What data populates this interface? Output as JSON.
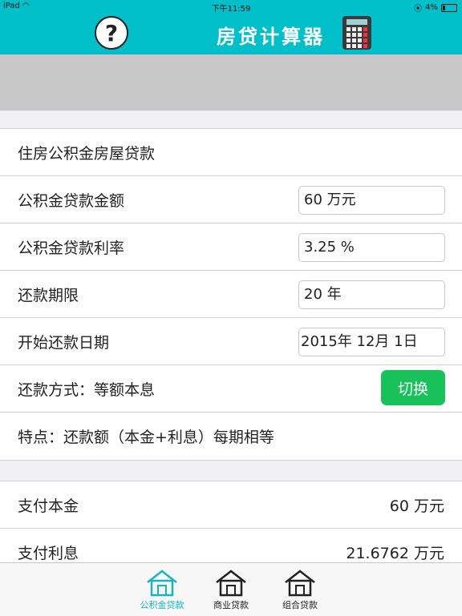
{
  "status_bar": {
    "device": "iPad",
    "time": "下午11:59",
    "battery": "4%"
  },
  "navbar": {
    "help_label": "?",
    "title": "房贷计算器"
  },
  "form": {
    "section_title": "住房公积金房屋贷款",
    "loan_amount_label": "公积金贷款金额",
    "loan_amount_value": "60 万元",
    "rate_label": "公积金贷款利率",
    "rate_value": "3.25 %",
    "term_label": "还款期限",
    "term_value": "20 年",
    "start_date_label": "开始还款日期",
    "start_date_value": "2015年 12月 1日",
    "method_label": "还款方式：等额本息",
    "switch_label": "切换",
    "feature_label": "特点：还款额（本金+利息）每期相等"
  },
  "results": {
    "principal_label": "支付本金",
    "principal_value": "60 万元",
    "interest_label": "支付利息",
    "interest_value": "21.6762 万元"
  },
  "tabs": [
    {
      "label": "公积金贷款",
      "active": true
    },
    {
      "label": "商业贷款",
      "active": false
    },
    {
      "label": "组合贷款",
      "active": false
    }
  ],
  "colors": {
    "accent": "#00bfc9",
    "switch": "#19c15a",
    "active_tab": "#18b4c0"
  }
}
